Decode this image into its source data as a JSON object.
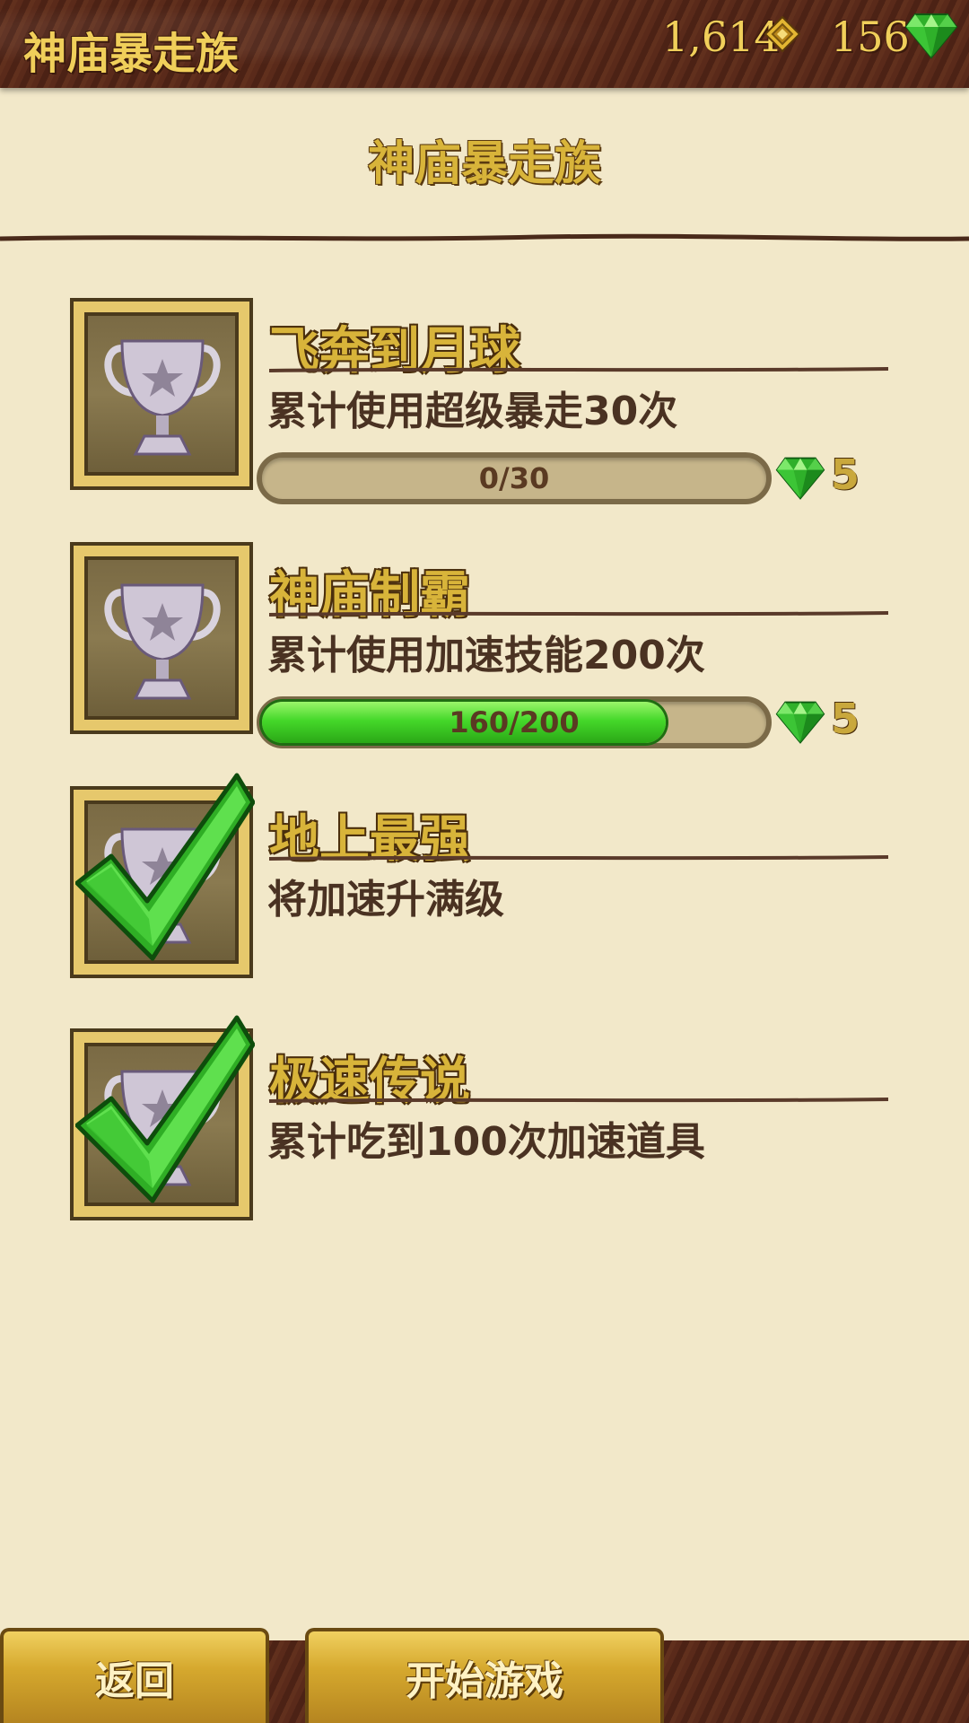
{
  "topbar": {
    "title": "神庙暴走族",
    "coins": "1,614",
    "gems": "156",
    "coin_icon": "gold-diamond-coin-icon",
    "gem_icon": "green-gem-icon"
  },
  "page_title": "神庙暴走族",
  "achievements": [
    {
      "title": "飞奔到月球",
      "description": "累计使用超级暴走30次",
      "progress_text": "0/30",
      "progress": 0.0,
      "reward": "5",
      "completed": false
    },
    {
      "title": "神庙制霸",
      "description": "累计使用加速技能200次",
      "progress_text": "160/200",
      "progress": 0.8,
      "reward": "5",
      "completed": false
    },
    {
      "title": "地上最强",
      "description": "将加速升满级",
      "completed": true
    },
    {
      "title": "极速传说",
      "description": "累计吃到100次加速道具",
      "completed": true
    }
  ],
  "buttons": {
    "back": "返回",
    "start": "开始游戏"
  },
  "colors": {
    "background": "#f2e8c9",
    "bar_brown": "#512417",
    "gold_text": "#d8b43a",
    "progress_green": "#45d82a"
  }
}
